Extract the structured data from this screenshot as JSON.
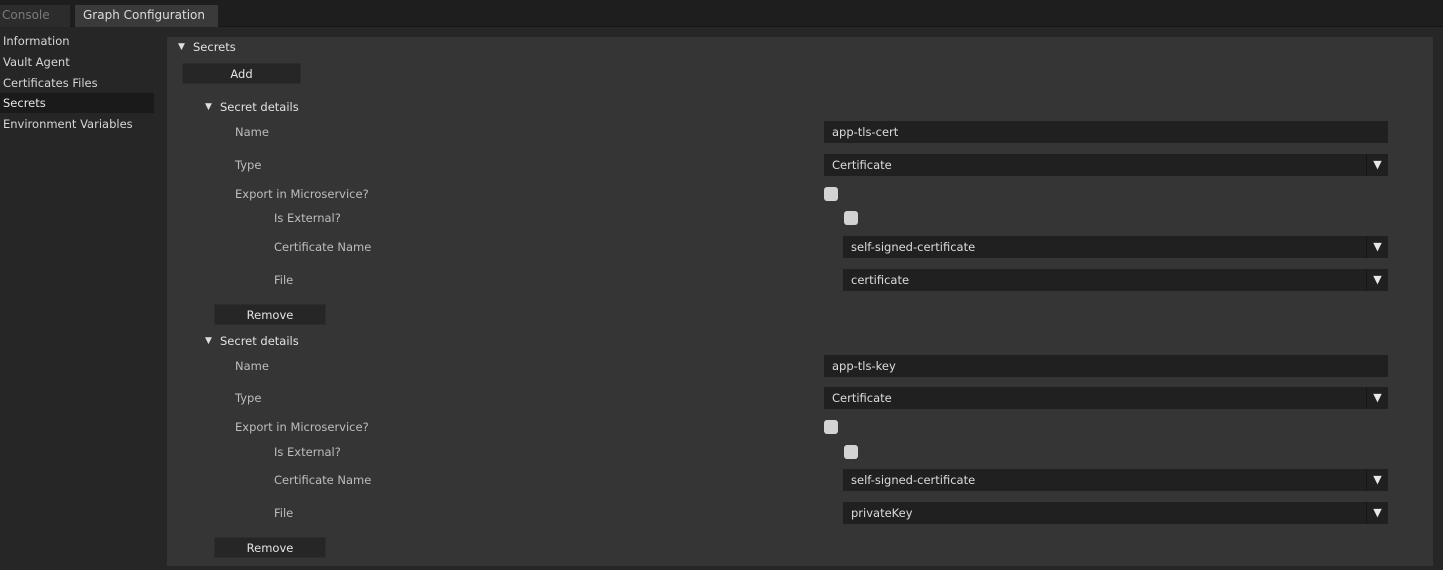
{
  "tabs": [
    {
      "label": "Console"
    },
    {
      "label": "Graph Configuration"
    }
  ],
  "sidebar": {
    "items": [
      {
        "label": "Information"
      },
      {
        "label": "Vault Agent"
      },
      {
        "label": "Certificates Files"
      },
      {
        "label": "Secrets"
      },
      {
        "label": "Environment Variables"
      }
    ],
    "active": "Secrets"
  },
  "secrets": {
    "title": "Secrets",
    "add_label": "Add",
    "labels": {
      "details": "Secret details",
      "name": "Name",
      "type": "Type",
      "export": "Export in Microservice?",
      "external": "Is External?",
      "cert_name": "Certificate Name",
      "file": "File",
      "remove": "Remove"
    },
    "items": [
      {
        "name": "app-tls-cert",
        "type": "Certificate",
        "export": false,
        "external": false,
        "cert_name": "self-signed-certificate",
        "file": "certificate"
      },
      {
        "name": "app-tls-key",
        "type": "Certificate",
        "export": false,
        "external": false,
        "cert_name": "self-signed-certificate",
        "file": "privateKey"
      }
    ]
  },
  "icons": {
    "expand": "triangle-down-icon",
    "dropdown": "dropdown-arrow-icon"
  },
  "colors": {
    "background": "#262626",
    "panel": "#353535",
    "field": "#202020",
    "active_sidebar": "#1a1a1a",
    "checkbox": "#d3d3d3"
  }
}
